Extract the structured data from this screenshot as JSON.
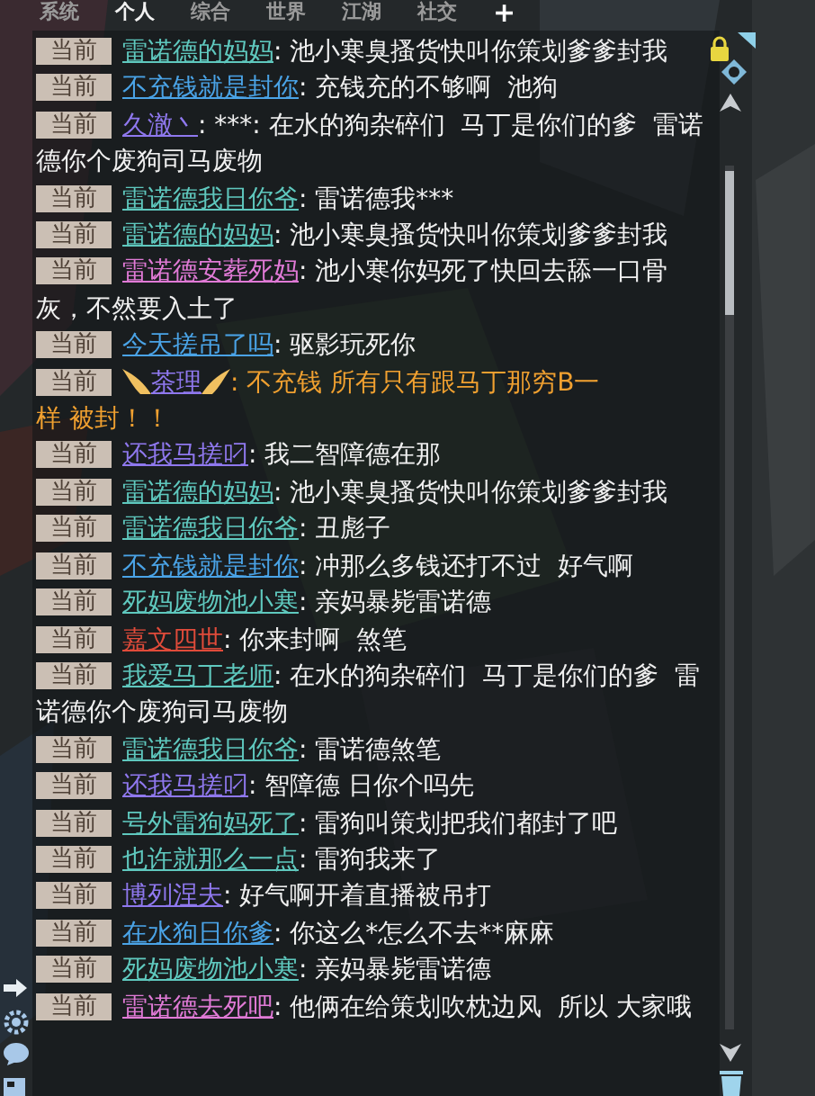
{
  "tabs": [
    {
      "label": "系统",
      "selected": false
    },
    {
      "label": "个人",
      "selected": true
    },
    {
      "label": "综合",
      "selected": false
    },
    {
      "label": "世界",
      "selected": false
    },
    {
      "label": "江湖",
      "selected": false
    },
    {
      "label": "社交",
      "selected": false
    }
  ],
  "add_tab": "+",
  "messages": [
    {
      "kind": "normal",
      "channel": "当前",
      "name": "雷诺德的妈妈",
      "color": "#5fc8be",
      "text": ": 池小寒臭搔货快叫你策划爹爹封我"
    },
    {
      "kind": "normal",
      "channel": "当前",
      "name": "不充钱就是封你",
      "color": "#4aa3e6",
      "text": ": 充钱充的不够啊  池狗"
    },
    {
      "kind": "normal",
      "channel": "当前",
      "name": "久澈丶",
      "color": "#8f78ee",
      "text": ": ***: 在水的狗杂碎们  马丁是你们的爹  雷诺",
      "text_cont": "德你个废狗司马废物"
    },
    {
      "kind": "normal",
      "channel": "当前",
      "name": "雷诺德我日你爷",
      "color": "#5fc8be",
      "text": ": 雷诺德我***"
    },
    {
      "kind": "normal",
      "channel": "当前",
      "name": "雷诺德的妈妈",
      "color": "#5fc8be",
      "text": ": 池小寒臭搔货快叫你策划爹爹封我"
    },
    {
      "kind": "normal",
      "channel": "当前",
      "name": "雷诺德安葬死妈",
      "color": "#e07ad6",
      "text": ": 池小寒你妈死了快回去舔一口骨",
      "text_cont": "灰，不然要入土了"
    },
    {
      "kind": "normal",
      "channel": "当前",
      "name": "今天搓吊了吗",
      "color": "#4aa3e6",
      "text": ": 驱影玩死你"
    },
    {
      "kind": "vip",
      "channel": "当前",
      "name": "茶理",
      "color": "#8f78ee",
      "text": ": 不充钱 所有只有跟马丁那穷B一",
      "text_cont": "样 被封！！"
    },
    {
      "kind": "normal",
      "channel": "当前",
      "name": "还我马搓叼",
      "color": "#8f78ee",
      "text": ": 我二智障德在那"
    },
    {
      "kind": "normal",
      "channel": "当前",
      "name": "雷诺德的妈妈",
      "color": "#5fc8be",
      "text": ": 池小寒臭搔货快叫你策划爹爹封我"
    },
    {
      "kind": "normal",
      "channel": "当前",
      "name": "雷诺德我日你爷",
      "color": "#5fc8be",
      "text": ": 丑彪子"
    },
    {
      "kind": "normal",
      "channel": "当前",
      "name": "不充钱就是封你",
      "color": "#4aa3e6",
      "text": ": 冲那么多钱还打不过  好气啊"
    },
    {
      "kind": "normal",
      "channel": "当前",
      "name": "死妈废物池小寒",
      "color": "#5fc8be",
      "text": ": 亲妈暴毙雷诺德"
    },
    {
      "kind": "normal",
      "channel": "当前",
      "name": "嘉文四世",
      "color": "#e04b3a",
      "text": ": 你来封啊  煞笔"
    },
    {
      "kind": "normal",
      "channel": "当前",
      "name": "我爱马丁老师",
      "color": "#5fc8be",
      "text": ": 在水的狗杂碎们  马丁是你们的爹  雷",
      "text_cont": "诺德你个废狗司马废物"
    },
    {
      "kind": "normal",
      "channel": "当前",
      "name": "雷诺德我日你爷",
      "color": "#5fc8be",
      "text": ": 雷诺德煞笔"
    },
    {
      "kind": "normal",
      "channel": "当前",
      "name": "还我马搓叼",
      "color": "#8f78ee",
      "text": ": 智障德 日你个吗先"
    },
    {
      "kind": "normal",
      "channel": "当前",
      "name": "号外雷狗妈死了",
      "color": "#5fc8be",
      "text": ": 雷狗叫策划把我们都封了吧"
    },
    {
      "kind": "normal",
      "channel": "当前",
      "name": "也许就那么一点",
      "color": "#5fc8be",
      "text": ": 雷狗我来了"
    },
    {
      "kind": "normal",
      "channel": "当前",
      "name": "博列涅夫",
      "color": "#8f78ee",
      "text": ": 好气啊开着直播被吊打"
    },
    {
      "kind": "normal",
      "channel": "当前",
      "name": "在水狗日你爹",
      "color": "#4aa3e6",
      "text": ": 你这么*怎么不去**麻麻"
    },
    {
      "kind": "normal",
      "channel": "当前",
      "name": "死妈废物池小寒",
      "color": "#5fc8be",
      "text": ": 亲妈暴毙雷诺德"
    },
    {
      "kind": "normal",
      "channel": "当前",
      "name": "雷诺德去死吧",
      "color": "#e07ad6",
      "text": ": 他俩在给策划吹枕边风  所以 大家哦"
    }
  ]
}
